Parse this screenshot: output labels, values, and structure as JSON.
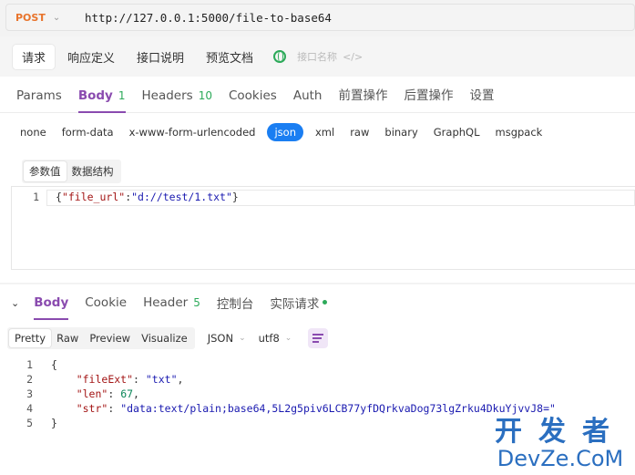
{
  "request": {
    "method": "POST",
    "url": "http://127.0.0.1:5000/file-to-base64"
  },
  "top_tabs": [
    "请求",
    "响应定义",
    "接口说明",
    "预览文档"
  ],
  "api_name_placeholder": "接口名称",
  "code_icon": "</>",
  "req_tabs": {
    "params": "Params",
    "body": "Body",
    "body_count": "1",
    "headers": "Headers",
    "headers_count": "10",
    "cookies": "Cookies",
    "auth": "Auth",
    "pre": "前置操作",
    "post": "后置操作",
    "settings": "设置"
  },
  "body_types": [
    "none",
    "form-data",
    "x-www-form-urlencoded",
    "json",
    "xml",
    "raw",
    "binary",
    "GraphQL",
    "msgpack"
  ],
  "body_sub_tabs": [
    "参数值",
    "数据结构"
  ],
  "request_body": {
    "line": "1",
    "open": "{",
    "key": "\"file_url\"",
    "colon": ":",
    "value": "\"d://test/1.txt\"",
    "close": "}"
  },
  "resp_tabs": {
    "body": "Body",
    "cookie": "Cookie",
    "header": "Header",
    "header_count": "5",
    "console": "控制台",
    "actual": "实际请求"
  },
  "format_tabs": [
    "Pretty",
    "Raw",
    "Preview",
    "Visualize"
  ],
  "format_select": "JSON",
  "encoding_select": "utf8",
  "response_body": {
    "open": "{",
    "close": "}",
    "fileExt_key": "\"fileExt\"",
    "fileExt_val": "\"txt\"",
    "len_key": "\"len\"",
    "len_val": "67",
    "str_key": "\"str\"",
    "str_val": "\"data:text/plain;base64,5L2g5piv6LCB77yfDQrkvaDog73lgZrku4DkuYjvvJ8=\""
  },
  "watermark": {
    "top": "开发者",
    "bottom": "DevZe.CoM"
  },
  "colors": {
    "accent": "#8a4baf",
    "method": "#e8742c",
    "json_active": "#1a7ef2",
    "count_green": "#2daa5a"
  }
}
